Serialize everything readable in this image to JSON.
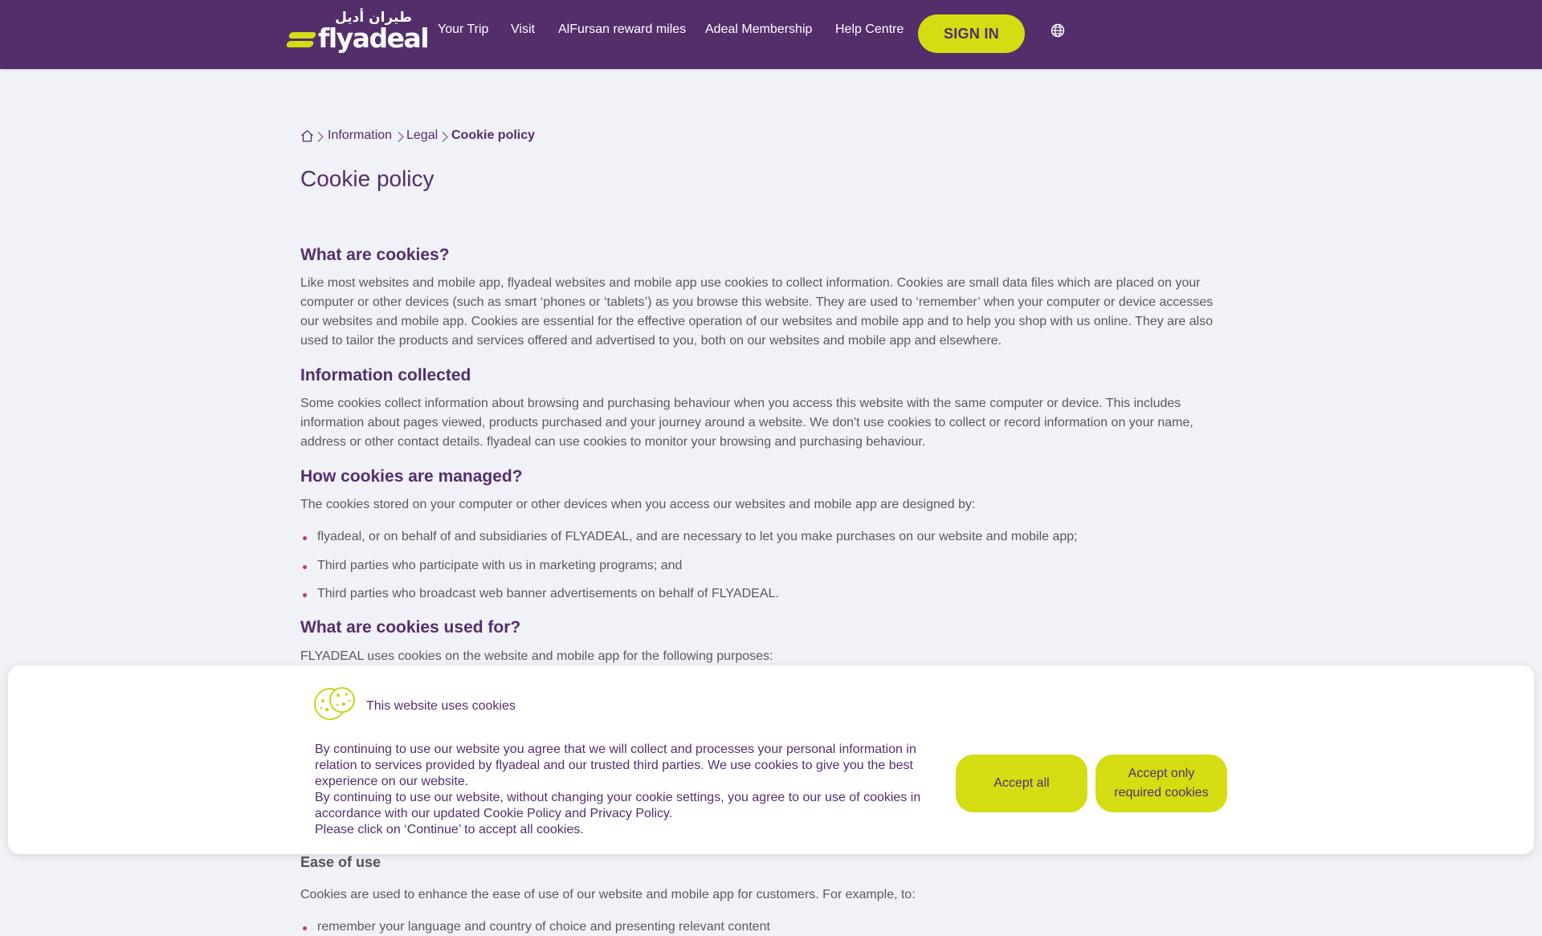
{
  "header": {
    "logo_arabic": "طيران أديل",
    "logo_text": "flyadeal",
    "nav": [
      {
        "label": "Your Trip"
      },
      {
        "label": "Visit"
      },
      {
        "label": "AlFursan reward miles"
      },
      {
        "label": "Adeal Membership"
      },
      {
        "label": "Help Centre"
      }
    ],
    "signin_label": "SIGN IN",
    "language_icon": "globe-icon"
  },
  "breadcrumb": {
    "home_icon": "home-icon",
    "items": [
      {
        "label": "Information"
      },
      {
        "label": "Legal"
      },
      {
        "label": "Cookie policy"
      }
    ]
  },
  "page": {
    "title": "Cookie policy",
    "sections": [
      {
        "heading": "What are cookies?",
        "body": "Like most websites and mobile app, flyadeal websites and mobile app use cookies to collect information. Cookies are small data files which are placed on your computer or other devices (such as smart ‘phones or ‘tablets’) as you browse this website. They are used to ‘remember’ when your computer or device accesses our websites and mobile app. Cookies are essential for the effective operation of our websites and mobile app and to help you shop with us online. They are also used to tailor the products and services offered and advertised to you, both on our websites and mobile app and elsewhere."
      },
      {
        "heading": "Information collected",
        "body": "Some cookies collect information about browsing and purchasing behaviour when you access this website with the same computer or device. This includes information about pages viewed, products purchased and your journey around a website. We don't use cookies to collect or record information on your name, address or other contact details. flyadeal can use cookies to monitor your browsing and purchasing behaviour."
      },
      {
        "heading": "How cookies are managed?",
        "body": "The cookies stored on your computer or other devices when you access our websites and mobile app are designed by:",
        "bullets": [
          "flyadeal, or on behalf of and subsidiaries of FLYADEAL, and are necessary to let you make purchases on our website and mobile app;",
          "Third parties who participate with us in marketing programs; and",
          "Third parties who broadcast web banner advertisements on behalf of FLYADEAL."
        ]
      },
      {
        "heading": "What are cookies used for?",
        "body": "FLYADEAL uses cookies on the website and mobile app for the following purposes:"
      }
    ],
    "ease_heading": "Ease of use",
    "ease_body": "Cookies are used to enhance the ease of use of our website and mobile app for customers. For example, to:",
    "ease_bullets": [
      "remember your language and country of choice and presenting relevant content"
    ]
  },
  "cookie_banner": {
    "icon": "cookie-icon",
    "title": "This website uses cookies",
    "p1": "By continuing to use our website you agree that we will collect and processes your personal information in relation to services provided by flyadeal and our trusted third parties. We use cookies to give you the best experience on our website.",
    "p2_before": "By continuing to use our website, without changing your cookie settings, you agree to our use of cookies in accordance with our updated ",
    "cookie_policy_link": "Cookie Policy",
    "p2_and": " and ",
    "privacy_policy_link": "Privacy Policy",
    "p2_after": ".",
    "p3": "Please click on ‘Continue’ to accept all cookies.",
    "accept_all_label": "Accept all",
    "accept_required_line1": "Accept only",
    "accept_required_line2": "required cookies"
  },
  "colors": {
    "brand_purple": "#532e6b",
    "brand_lime": "#d3dd12",
    "background": "#f1f1f8",
    "bullet_dot": "#c0357f"
  }
}
